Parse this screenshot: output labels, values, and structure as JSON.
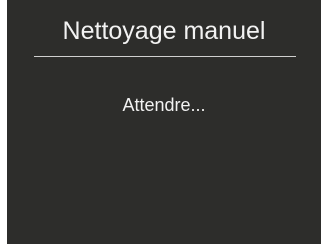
{
  "screen": {
    "title": "Nettoyage manuel",
    "status": "Attendre..."
  }
}
